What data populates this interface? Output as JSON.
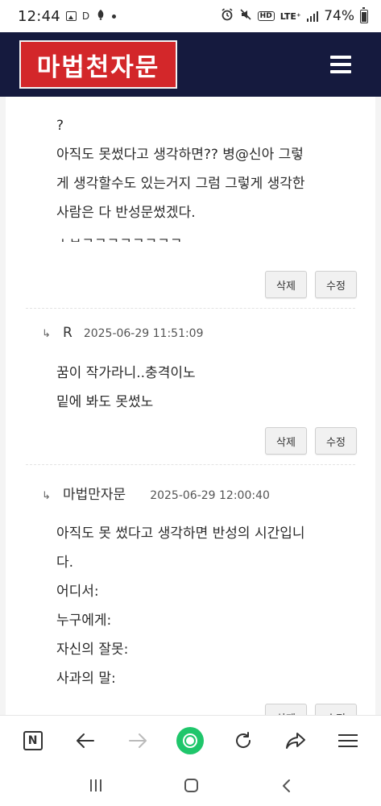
{
  "status_bar": {
    "time": "12:44",
    "left_icons": [
      "image-icon",
      "d-icon",
      "app-icon",
      "dot-icon"
    ],
    "d_label": "D",
    "hd_label": "HD",
    "lte_label": "LTE⁺",
    "battery_text": "74%",
    "battery_level": 0.74
  },
  "header": {
    "logo_text": "마법천자문",
    "brand_color": "#d3272a",
    "header_bg": "#151a3e"
  },
  "comments": [
    {
      "lines": [
        "?",
        "아직도 못썼다고 생각하면?? 병@신아 그렇",
        "게 생각할수도 있는거지 그럼 그렇게 생각한",
        "사람은 다 반성문썼겠다.",
        "ㅅㅂㅋㅋㅋㅋㅋㅋㅋㅋ"
      ],
      "delete_label": "삭제",
      "edit_label": "수정"
    },
    {
      "author": "R",
      "date": "2025-06-29 11:51:09",
      "lines": [
        "꿈이 작가라니..충격이노",
        "밑에 봐도 못썼노"
      ],
      "delete_label": "삭제",
      "edit_label": "수정"
    },
    {
      "author": "마법만자문",
      "date": "2025-06-29 12:00:40",
      "lines": [
        "아직도 못 썼다고 생각하면 반성의 시간입니",
        "다.",
        "어디서:",
        "누구에게:",
        "자신의 잘못:",
        "사과의 말:"
      ],
      "delete_label": "삭제",
      "edit_label": "수정"
    }
  ],
  "toolbar": {
    "n_label": "N",
    "items": [
      "n-home-icon",
      "back-arrow-icon",
      "forward-arrow-icon",
      "green-circle-icon",
      "refresh-icon",
      "share-icon",
      "menu-icon"
    ]
  },
  "navbar": {
    "items": [
      "recent-apps-icon",
      "home-icon",
      "back-icon"
    ]
  }
}
